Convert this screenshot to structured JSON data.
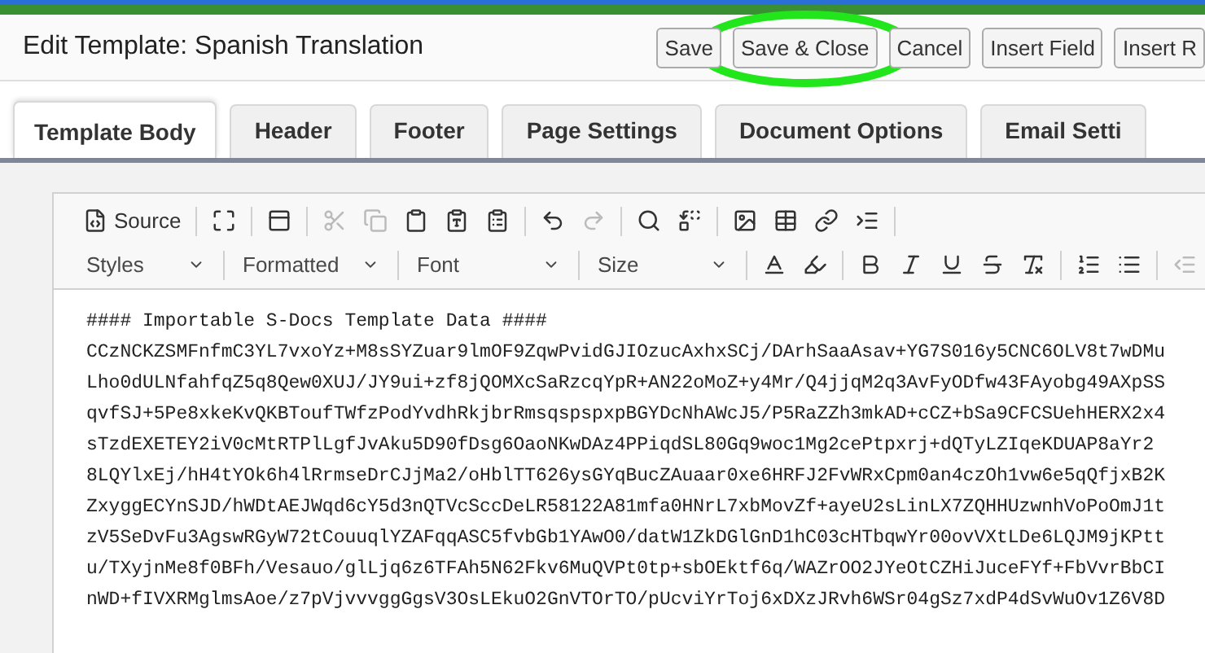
{
  "window": {
    "title": "Edit Template: Spanish Translation"
  },
  "buttons": [
    {
      "label": "Save",
      "highlighted": false
    },
    {
      "label": "Save & Close",
      "highlighted": true
    },
    {
      "label": "Cancel",
      "highlighted": false
    },
    {
      "label": "Insert Field",
      "highlighted": false
    },
    {
      "label": "Insert R",
      "highlighted": false
    }
  ],
  "tabs": [
    {
      "label": "Template Body",
      "selected": true
    },
    {
      "label": "Header",
      "selected": false
    },
    {
      "label": "Footer",
      "selected": false
    },
    {
      "label": "Page Settings",
      "selected": false
    },
    {
      "label": "Document Options",
      "selected": false
    },
    {
      "label": "Email Setti",
      "selected": false
    }
  ],
  "editor": {
    "source_button": "Source",
    "dropdowns": [
      "Styles",
      "Formatted",
      "Font",
      "Size"
    ],
    "lines": [
      "#### Importable S-Docs Template Data ####",
      "CCzNCKZSMFnfmC3YL7vxoYz+M8sSYZuar9lmOF9ZqwPvidGJIOzucAxhxSCj/DArhSaaAsav+YG7S016y5CNC6OLV8t7wDMu",
      "Lho0dULNfahfqZ5q8Qew0XUJ/JY9ui+zf8jQOMXcSaRzcqYpR+AN22oMoZ+y4Mr/Q4jjqM2q3AvFyODfw43FAyobg49AXpSS",
      "qvfSJ+5Pe8xkeKvQKBToufTWfzPodYvdhRkjbrRmsqspspxpBGYDcNhAWcJ5/P5RaZZh3mkAD+cCZ+bSa9CFCSUehHERX2x4",
      "sTzdEXETEY2iV0cMtRTPlLgfJvAku5D90fDsg6OaoNKwDAz4PPiqdSL80Gq9woc1Mg2cePtpxrj+dQTyLZIqeKDUAP8aYr2",
      "8LQYlxEj/hH4tYOk6h4lRrmseDrCJjMa2/oHblTT626ysGYqBucZAuaar0xe6HRFJ2FvWRxCpm0an4czOh1vw6e5qQfjxB2K",
      "ZxyggECYnSJD/hWDtAEJWqd6cY5d3nQTVcSccDeLR58122A81mfa0HNrL7xbMovZf+ayeU2sLinLX7ZQHHUzwnhVoPoOmJ1t",
      "zV5SeDvFu3AgswRGyW72tCouuqlYZAFqqASC5fvbGb1YAwO0/datW1ZkDGlGnD1hC03cHTbqwYr00ovVXtLDe6LQJM9jKPtt",
      "u/TXyjnMe8f0BFh/Vesauo/glLjq6z6TFAh5N62Fkv6MuQVPt0tp+sbOEktf6q/WAZrOO2JYeOtCZHiJuceFYf+FbVvrBbCI",
      "nWD+fIVXRMglmsAoe/z7pVjvvvggGgsV3OsLEkuO2GnVTOrTO/pUcviYrToj6xDXzJRvh6WSr04gSz7xdP4dSvWuOv1Z6V8D"
    ]
  }
}
